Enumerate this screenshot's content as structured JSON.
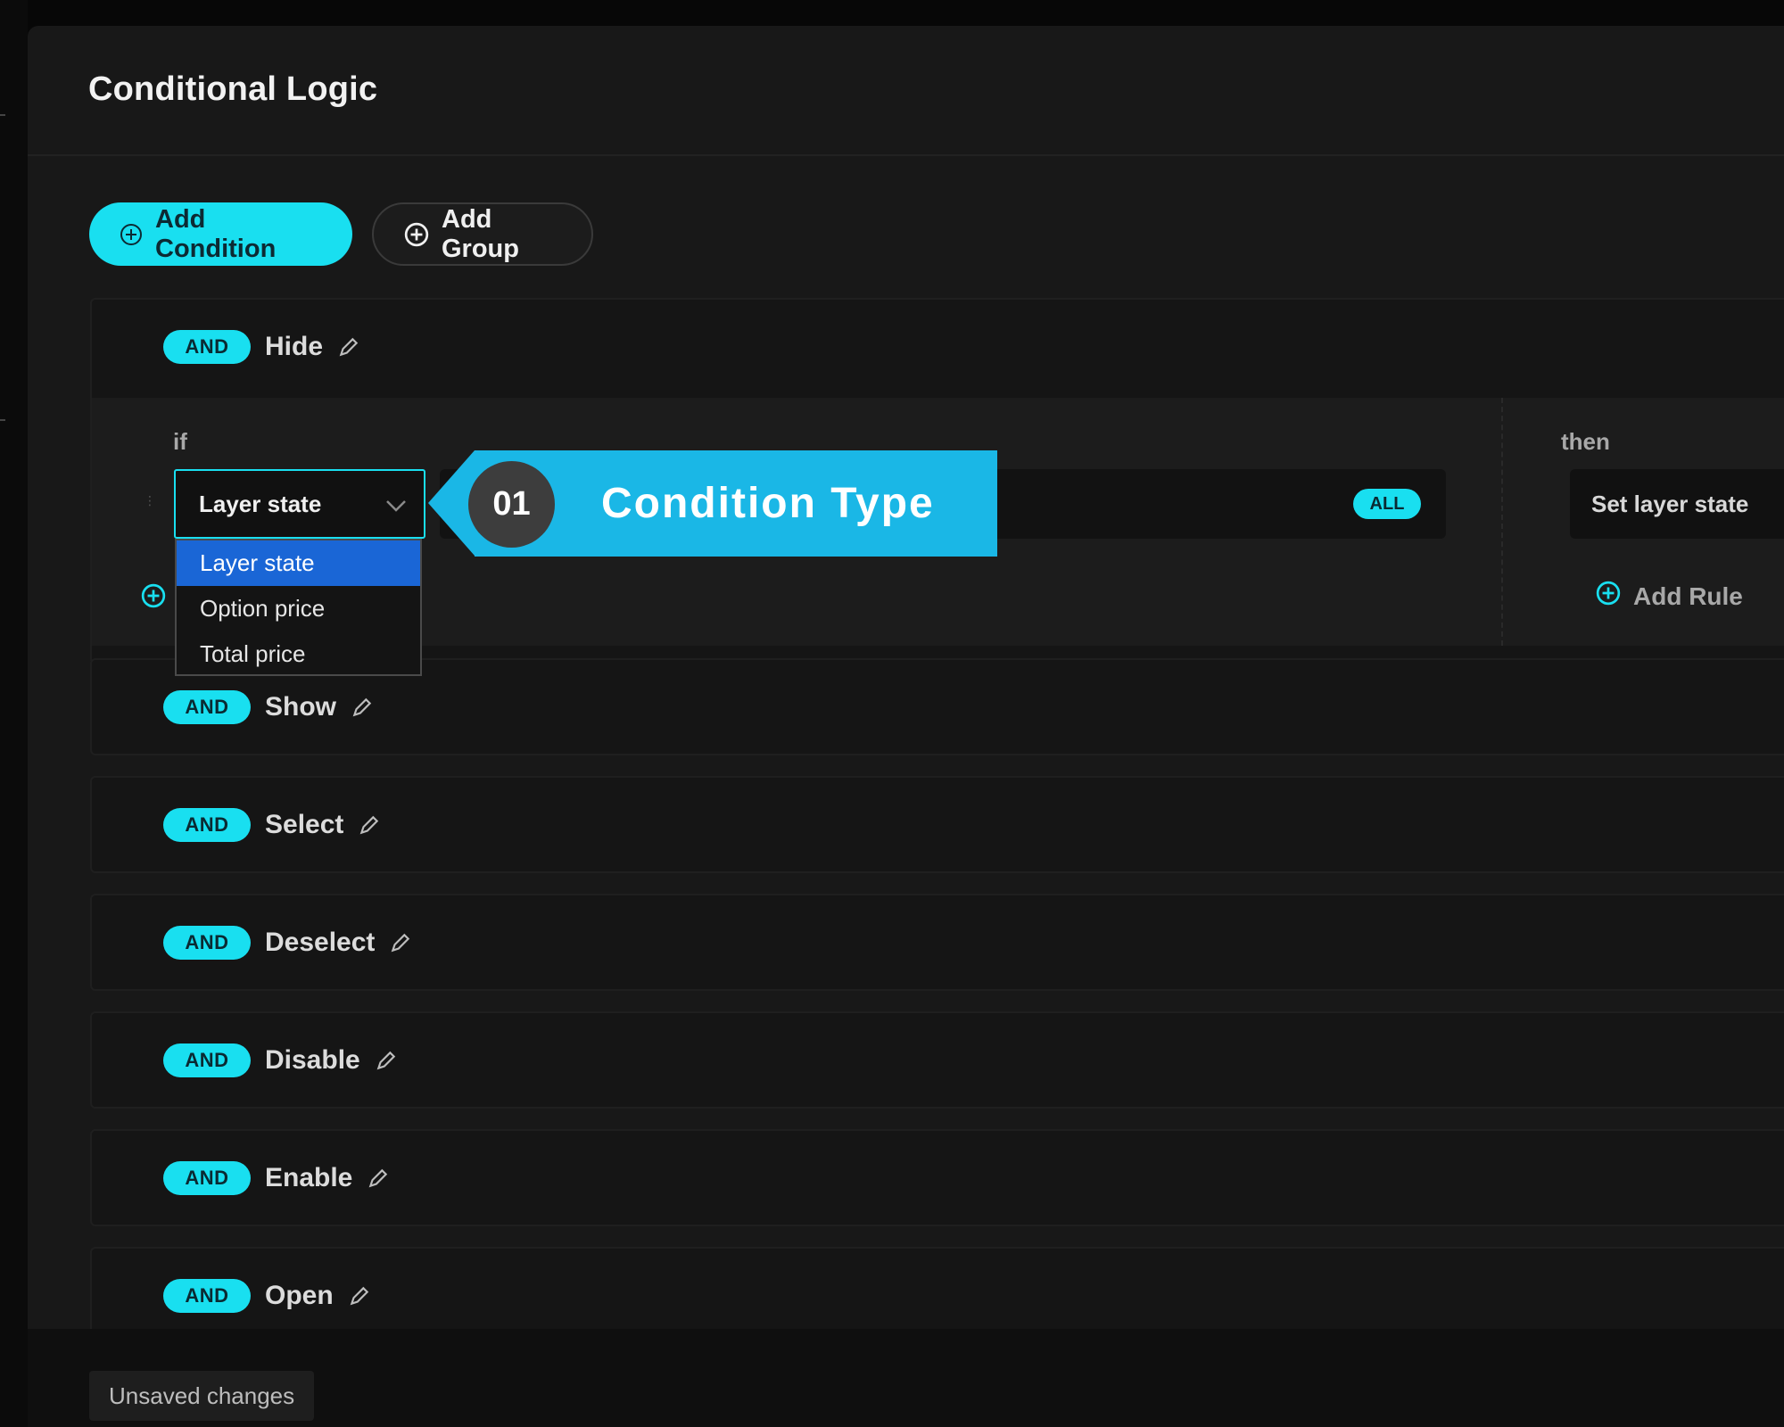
{
  "header": {
    "title": "Conditional Logic"
  },
  "toolbar": {
    "add_condition_label": "Add Condition",
    "add_group_label": "Add Group"
  },
  "groups": [
    {
      "operator": "AND",
      "name": "Hide",
      "rule": {
        "if_label": "if",
        "then_label": "then",
        "condition_type": "Layer state",
        "match_badge": "ALL",
        "action": "Set layer state",
        "add_rule_label": "Add Rule"
      }
    },
    {
      "operator": "AND",
      "name": "Show"
    },
    {
      "operator": "AND",
      "name": "Select"
    },
    {
      "operator": "AND",
      "name": "Deselect"
    },
    {
      "operator": "AND",
      "name": "Disable"
    },
    {
      "operator": "AND",
      "name": "Enable"
    },
    {
      "operator": "AND",
      "name": "Open"
    }
  ],
  "dropdown": {
    "options": [
      "Layer state",
      "Option price",
      "Total price"
    ],
    "selected": "Layer state"
  },
  "callout": {
    "number": "01",
    "text": "Condition Type"
  },
  "footer": {
    "status": "Unsaved changes"
  },
  "colors": {
    "accent": "#19dff0",
    "callout": "#1ab7e6",
    "selected_option": "#1a66d6",
    "background": "#181818"
  },
  "icons": {
    "add": "plus-circle-icon",
    "edit": "pencil-icon",
    "dropdown": "chevron-down-icon"
  }
}
